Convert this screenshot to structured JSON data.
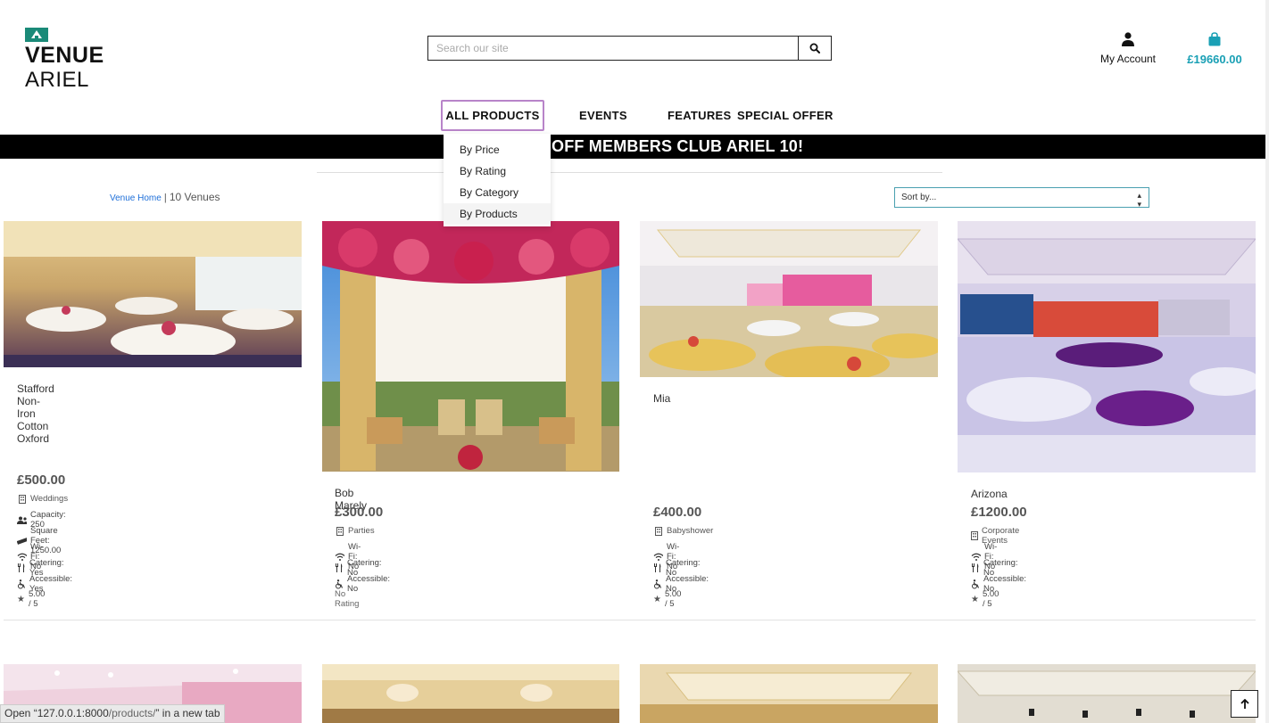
{
  "logo": {
    "line1": "VENUE",
    "line2": "ARIEL"
  },
  "search": {
    "placeholder": "Search our site"
  },
  "account": {
    "label": "My Account"
  },
  "bag": {
    "total": "£19660.00"
  },
  "nav": {
    "all_products": "ALL PRODUCTS",
    "events": "EVENTS",
    "features": "FEATURES",
    "special_offer": "SPECIAL OFFER"
  },
  "dropdown": [
    "By Price",
    "By Rating",
    "By Category",
    "By Products"
  ],
  "banner": {
    "text": "OFF MEMBERS CLUB ARIEL 10!"
  },
  "breadcrumb": {
    "home": "Venue Home",
    "separator": "|",
    "count": "10 Venues"
  },
  "sort": {
    "selected": "Sort by..."
  },
  "cards": [
    {
      "title": "Stafford Non-Iron Cotton Oxford",
      "price": "£500.00",
      "category": "Weddings",
      "capacity": "Capacity: 250",
      "sqft": "Square Feet: 1250.00",
      "wifi": "Wi-Fi: No",
      "catering": "Catering: Yes",
      "accessible": "Accessible: Yes",
      "rating": "5.00 / 5"
    },
    {
      "title": "Bob Marely",
      "price": "£300.00",
      "category": "Parties",
      "wifi": "Wi-Fi: No",
      "catering": "Catering: No",
      "accessible": "Accessible: No",
      "rating": "No Rating"
    },
    {
      "title": "Mia",
      "price": "£400.00",
      "category": "Babyshower",
      "wifi": "Wi-Fi: No",
      "catering": "Catering: No",
      "accessible": "Accessible: No",
      "rating": "5.00 / 5"
    },
    {
      "title": "Arizona",
      "price": "£1200.00",
      "category": "Corporate Events",
      "wifi": "Wi-Fi: No",
      "catering": "Catering: No",
      "accessible": "Accessible: No",
      "rating": "5.00 / 5"
    }
  ],
  "status_bar": {
    "prefix": "Open “",
    "url": "127.0.0.1:8000",
    "path": "/products/",
    "suffix": "” in a new tab"
  },
  "colors": {
    "accent": "#1aa0b5",
    "logo": "#1a8a78",
    "nav_focus": "#b884c9",
    "link": "#1e6fd9"
  },
  "icons": [
    "search-icon",
    "user-icon",
    "shopping-bag-icon",
    "building-icon",
    "users-icon",
    "ruler-icon",
    "wifi-icon",
    "utensils-icon",
    "wheelchair-icon",
    "star-icon",
    "arrow-up-icon"
  ]
}
